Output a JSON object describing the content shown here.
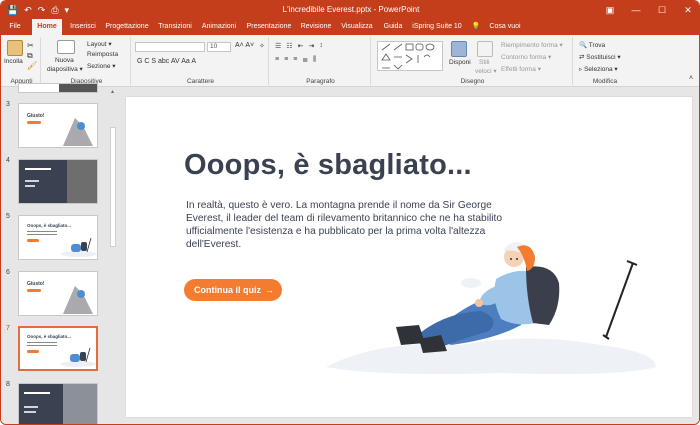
{
  "titlebar": {
    "title": "L'incredibile Everest.pptx  -  PowerPoint",
    "qat": [
      "💾",
      "↶",
      "↷",
      "⎙",
      "▾"
    ],
    "window_buttons": [
      "▣",
      "—",
      "☐",
      "✕"
    ]
  },
  "tabs": [
    {
      "label": "File"
    },
    {
      "label": "Home"
    },
    {
      "label": "Inserisci"
    },
    {
      "label": "Progettazione"
    },
    {
      "label": "Transizioni"
    },
    {
      "label": "Animazioni"
    },
    {
      "label": "Presentazione"
    },
    {
      "label": "Revisione"
    },
    {
      "label": "Visualizza"
    },
    {
      "label": "Guida"
    },
    {
      "label": "iSpring Suite 10"
    },
    {
      "label": "Cosa vuoi fare?"
    }
  ],
  "ribbon": {
    "appunti": {
      "label": "Appunti",
      "incolla": "Incolla"
    },
    "diapositive": {
      "label": "Diapositive",
      "nuova": "Nuova",
      "diapositiva": "diapositiva ▾",
      "layout": "Layout ▾",
      "reimposta": "Reimposta",
      "sezione": "Sezione ▾"
    },
    "carattere": {
      "label": "Carattere",
      "font_size": "10",
      "format_row": "G  C  S  abc  AV  Aa  A"
    },
    "paragrafo": {
      "label": "Paragrafo"
    },
    "disegno": {
      "label": "Disegno",
      "disponi": "Disponi",
      "stili": "Stili",
      "veloci": "veloci ▾",
      "riempimento": "Riempimento forma ▾",
      "contorno": "Contorno forma ▾",
      "effetti": "Effetti forma ▾"
    },
    "modifica": {
      "label": "Modifica",
      "trova": "Trova",
      "sostituisci": "Sostituisci ▾",
      "seleziona": "Seleziona ▾"
    }
  },
  "thumbnails": [
    {
      "num": "3",
      "text": "Giusto!"
    },
    {
      "num": "4",
      "text": ""
    },
    {
      "num": "5",
      "text": "Ooops, è sbagliato..."
    },
    {
      "num": "6",
      "text": "Giusto!"
    },
    {
      "num": "7",
      "text": "Ooops, è sbagliato..."
    },
    {
      "num": "8",
      "text": ""
    }
  ],
  "slide": {
    "heading": "Ooops, è sbagliato...",
    "body": "In realtà, questo è vero. La montagna prende il nome da Sir George Everest, il leader del team di rilevamento britannico che ne ha stabilito ufficialmente l'esistenza e ha pubblicato per la prima volta l'altezza dell'Everest.",
    "cta_label": "Continua il quiz",
    "cta_arrow": "→"
  },
  "colors": {
    "accent": "#c43e1c",
    "cta": "#f47c30",
    "heading": "#3a4252",
    "slide_dark": "#3a4252"
  }
}
